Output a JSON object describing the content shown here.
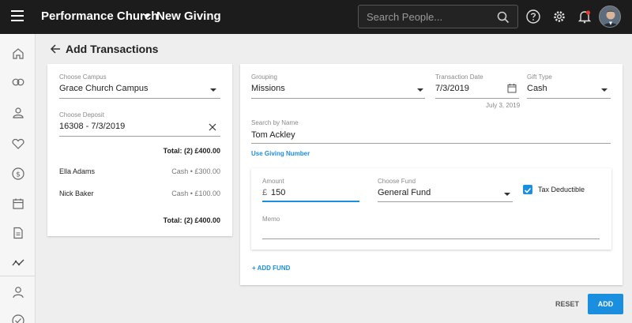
{
  "topbar": {
    "org_name": "Performance Church",
    "app_title": "New Giving",
    "search_placeholder": "Search People..."
  },
  "page": {
    "title": "Add Transactions"
  },
  "deposit_card": {
    "campus_label": "Choose Campus",
    "campus_value": "Grace Church Campus",
    "deposit_label": "Choose Deposit",
    "deposit_value": "16308 - 7/3/2019",
    "total_top": "Total: (2) £400.00",
    "transactions": [
      {
        "name": "Ella Adams",
        "detail": "Cash • £300.00"
      },
      {
        "name": "Nick Baker",
        "detail": "Cash • £100.00"
      }
    ],
    "total_bottom": "Total: (2) £400.00"
  },
  "transaction_card": {
    "grouping_label": "Grouping",
    "grouping_value": "Missions",
    "date_label": "Transaction Date",
    "date_value": "7/3/2019",
    "date_helper": "July 3, 2019",
    "gift_type_label": "Gift Type",
    "gift_type_value": "Cash",
    "search_name_label": "Search by Name",
    "search_name_value": "Tom Ackley",
    "use_giving_number": "Use Giving Number",
    "amount_label": "Amount",
    "currency_symbol": "£",
    "amount_value": "150",
    "fund_label": "Choose Fund",
    "fund_value": "General Fund",
    "tax_deductible_label": "Tax Deductible",
    "tax_deductible_checked": true,
    "memo_label": "Memo",
    "memo_value": "",
    "add_fund": "+ ADD FUND"
  },
  "actions": {
    "reset": "RESET",
    "add": "ADD"
  },
  "colors": {
    "accent": "#1a8fe0",
    "topbar": "#1c1c1c",
    "notification": "#e53935"
  },
  "icons": {
    "nav": [
      "home-icon",
      "giving-icon",
      "people-icon",
      "heart-icon",
      "dollar-icon",
      "calendar-icon",
      "document-icon",
      "analytics-icon",
      "person-icon",
      "check-circle-icon"
    ]
  }
}
